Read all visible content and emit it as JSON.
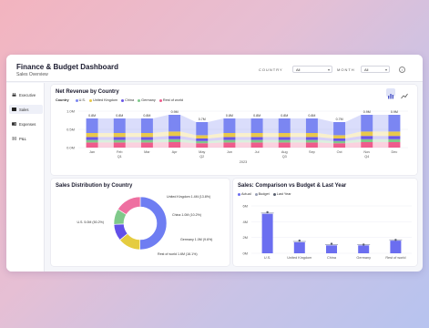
{
  "header": {
    "title": "Finance & Budget Dashboard",
    "subtitle": "Sales Overview",
    "country_label": "COUNTRY",
    "country_value": "All",
    "month_label": "MONTH",
    "month_value": "All",
    "info_label": "i"
  },
  "sidebar": {
    "items": [
      {
        "label": "Executive",
        "active": false,
        "icon": "people-icon"
      },
      {
        "label": "Sales",
        "active": true,
        "icon": "sales-icon"
      },
      {
        "label": "Expenses",
        "active": false,
        "icon": "wallet-icon"
      },
      {
        "label": "P&L",
        "active": false,
        "icon": "document-icon"
      }
    ]
  },
  "revenue": {
    "title": "Net Revenue by Country",
    "legend_key": "Country",
    "legend": [
      {
        "name": "U.S.",
        "color": "#7b86f2"
      },
      {
        "name": "United Kingdom",
        "color": "#e8c84a"
      },
      {
        "name": "China",
        "color": "#6a56e6"
      },
      {
        "name": "Germany",
        "color": "#7fc98a"
      },
      {
        "name": "Rest of world",
        "color": "#ef5b8c"
      }
    ],
    "view_bar_icon": "bar-chart-icon",
    "view_line_icon": "line-chart-icon"
  },
  "distribution": {
    "title": "Sales Distribution by Country"
  },
  "comparison": {
    "title": "Sales: Comparison vs Budget & Last Year",
    "legend": [
      {
        "name": "Actual",
        "color": "#6b6ef0"
      },
      {
        "name": "Budget",
        "color": "#9aa0b5"
      },
      {
        "name": "Last Year",
        "color": "#5a6070"
      }
    ]
  },
  "chart_data": [
    {
      "type": "bar",
      "title": "Net Revenue by Country",
      "categories": [
        "Jan",
        "Feb",
        "Mar",
        "Apr",
        "May",
        "Jun",
        "Jul",
        "Aug",
        "Sep",
        "Oct",
        "Nov",
        "Dec"
      ],
      "quarters": [
        "Q1",
        "Q2",
        "Q3",
        "Q4"
      ],
      "year": "2023",
      "y_ticks": [
        "1.0M",
        "0.5M",
        "0.0M"
      ],
      "ylim": [
        0,
        1.0
      ],
      "totals": [
        0.8,
        0.8,
        0.8,
        0.9,
        0.7,
        0.8,
        0.8,
        0.8,
        0.8,
        0.7,
        0.9,
        0.9
      ],
      "total_labels": [
        "0.8M",
        "0.8M",
        "0.8M",
        "0.9M",
        "0.7M",
        "0.8M",
        "0.8M",
        "0.8M",
        "0.8M",
        "0.7M",
        "0.9M",
        "0.9M"
      ],
      "series": [
        {
          "name": "Rest of world",
          "values": [
            0.14,
            0.14,
            0.14,
            0.15,
            0.12,
            0.14,
            0.14,
            0.14,
            0.14,
            0.12,
            0.15,
            0.15
          ]
        },
        {
          "name": "Germany",
          "values": [
            0.07,
            0.07,
            0.07,
            0.08,
            0.06,
            0.07,
            0.07,
            0.07,
            0.07,
            0.06,
            0.08,
            0.08
          ]
        },
        {
          "name": "China",
          "values": [
            0.08,
            0.08,
            0.08,
            0.09,
            0.07,
            0.08,
            0.08,
            0.08,
            0.08,
            0.07,
            0.09,
            0.09
          ]
        },
        {
          "name": "United Kingdom",
          "values": [
            0.11,
            0.11,
            0.11,
            0.12,
            0.09,
            0.11,
            0.11,
            0.11,
            0.11,
            0.09,
            0.12,
            0.12
          ]
        },
        {
          "name": "U.S.",
          "values": [
            0.4,
            0.4,
            0.4,
            0.46,
            0.36,
            0.4,
            0.4,
            0.4,
            0.4,
            0.36,
            0.46,
            0.46
          ]
        }
      ]
    },
    {
      "type": "pie",
      "title": "Sales Distribution by Country",
      "slices": [
        {
          "name": "U.S.",
          "label": "U.S. 5.0M (50.2%)",
          "value": 50.2,
          "color": "#6e7df2"
        },
        {
          "name": "United Kingdom",
          "label": "United Kingdom 1.4M (13.8%)",
          "value": 13.8,
          "color": "#e5cc3f"
        },
        {
          "name": "China",
          "label": "China 1.0M (10.2%)",
          "value": 10.2,
          "color": "#6250e8"
        },
        {
          "name": "Germany",
          "label": "Germany 1.0M (9.6%)",
          "value": 9.6,
          "color": "#7fc98a"
        },
        {
          "name": "Rest of world",
          "label": "Rest of world 1.6M (16.1%)",
          "value": 16.1,
          "color": "#ee6fa0"
        }
      ]
    },
    {
      "type": "bar",
      "title": "Sales: Comparison vs Budget & Last Year",
      "categories": [
        "U.S.",
        "United Kingdom",
        "China",
        "Germany",
        "Rest of world"
      ],
      "y_ticks": [
        "6M",
        "4M",
        "2M",
        "0M"
      ],
      "ylim": [
        0,
        6
      ],
      "series": [
        {
          "name": "Actual",
          "values": [
            5.0,
            1.4,
            1.0,
            1.0,
            1.6
          ]
        },
        {
          "name": "Budget",
          "values": [
            5.1,
            1.5,
            1.1,
            1.1,
            1.7
          ]
        },
        {
          "name": "Last Year",
          "values": [
            5.2,
            1.6,
            1.2,
            1.1,
            1.7
          ]
        }
      ]
    }
  ]
}
